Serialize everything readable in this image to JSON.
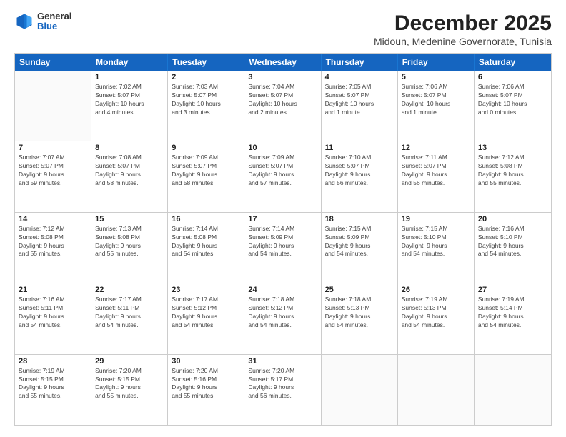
{
  "header": {
    "logo": {
      "general": "General",
      "blue": "Blue"
    },
    "title": "December 2025",
    "subtitle": "Midoun, Medenine Governorate, Tunisia"
  },
  "calendar": {
    "days_of_week": [
      "Sunday",
      "Monday",
      "Tuesday",
      "Wednesday",
      "Thursday",
      "Friday",
      "Saturday"
    ],
    "weeks": [
      [
        {
          "day": "",
          "info": ""
        },
        {
          "day": "1",
          "info": "Sunrise: 7:02 AM\nSunset: 5:07 PM\nDaylight: 10 hours\nand 4 minutes."
        },
        {
          "day": "2",
          "info": "Sunrise: 7:03 AM\nSunset: 5:07 PM\nDaylight: 10 hours\nand 3 minutes."
        },
        {
          "day": "3",
          "info": "Sunrise: 7:04 AM\nSunset: 5:07 PM\nDaylight: 10 hours\nand 2 minutes."
        },
        {
          "day": "4",
          "info": "Sunrise: 7:05 AM\nSunset: 5:07 PM\nDaylight: 10 hours\nand 1 minute."
        },
        {
          "day": "5",
          "info": "Sunrise: 7:06 AM\nSunset: 5:07 PM\nDaylight: 10 hours\nand 1 minute."
        },
        {
          "day": "6",
          "info": "Sunrise: 7:06 AM\nSunset: 5:07 PM\nDaylight: 10 hours\nand 0 minutes."
        }
      ],
      [
        {
          "day": "7",
          "info": "Sunrise: 7:07 AM\nSunset: 5:07 PM\nDaylight: 9 hours\nand 59 minutes."
        },
        {
          "day": "8",
          "info": "Sunrise: 7:08 AM\nSunset: 5:07 PM\nDaylight: 9 hours\nand 58 minutes."
        },
        {
          "day": "9",
          "info": "Sunrise: 7:09 AM\nSunset: 5:07 PM\nDaylight: 9 hours\nand 58 minutes."
        },
        {
          "day": "10",
          "info": "Sunrise: 7:09 AM\nSunset: 5:07 PM\nDaylight: 9 hours\nand 57 minutes."
        },
        {
          "day": "11",
          "info": "Sunrise: 7:10 AM\nSunset: 5:07 PM\nDaylight: 9 hours\nand 56 minutes."
        },
        {
          "day": "12",
          "info": "Sunrise: 7:11 AM\nSunset: 5:07 PM\nDaylight: 9 hours\nand 56 minutes."
        },
        {
          "day": "13",
          "info": "Sunrise: 7:12 AM\nSunset: 5:08 PM\nDaylight: 9 hours\nand 55 minutes."
        }
      ],
      [
        {
          "day": "14",
          "info": "Sunrise: 7:12 AM\nSunset: 5:08 PM\nDaylight: 9 hours\nand 55 minutes."
        },
        {
          "day": "15",
          "info": "Sunrise: 7:13 AM\nSunset: 5:08 PM\nDaylight: 9 hours\nand 55 minutes."
        },
        {
          "day": "16",
          "info": "Sunrise: 7:14 AM\nSunset: 5:08 PM\nDaylight: 9 hours\nand 54 minutes."
        },
        {
          "day": "17",
          "info": "Sunrise: 7:14 AM\nSunset: 5:09 PM\nDaylight: 9 hours\nand 54 minutes."
        },
        {
          "day": "18",
          "info": "Sunrise: 7:15 AM\nSunset: 5:09 PM\nDaylight: 9 hours\nand 54 minutes."
        },
        {
          "day": "19",
          "info": "Sunrise: 7:15 AM\nSunset: 5:10 PM\nDaylight: 9 hours\nand 54 minutes."
        },
        {
          "day": "20",
          "info": "Sunrise: 7:16 AM\nSunset: 5:10 PM\nDaylight: 9 hours\nand 54 minutes."
        }
      ],
      [
        {
          "day": "21",
          "info": "Sunrise: 7:16 AM\nSunset: 5:11 PM\nDaylight: 9 hours\nand 54 minutes."
        },
        {
          "day": "22",
          "info": "Sunrise: 7:17 AM\nSunset: 5:11 PM\nDaylight: 9 hours\nand 54 minutes."
        },
        {
          "day": "23",
          "info": "Sunrise: 7:17 AM\nSunset: 5:12 PM\nDaylight: 9 hours\nand 54 minutes."
        },
        {
          "day": "24",
          "info": "Sunrise: 7:18 AM\nSunset: 5:12 PM\nDaylight: 9 hours\nand 54 minutes."
        },
        {
          "day": "25",
          "info": "Sunrise: 7:18 AM\nSunset: 5:13 PM\nDaylight: 9 hours\nand 54 minutes."
        },
        {
          "day": "26",
          "info": "Sunrise: 7:19 AM\nSunset: 5:13 PM\nDaylight: 9 hours\nand 54 minutes."
        },
        {
          "day": "27",
          "info": "Sunrise: 7:19 AM\nSunset: 5:14 PM\nDaylight: 9 hours\nand 54 minutes."
        }
      ],
      [
        {
          "day": "28",
          "info": "Sunrise: 7:19 AM\nSunset: 5:15 PM\nDaylight: 9 hours\nand 55 minutes."
        },
        {
          "day": "29",
          "info": "Sunrise: 7:20 AM\nSunset: 5:15 PM\nDaylight: 9 hours\nand 55 minutes."
        },
        {
          "day": "30",
          "info": "Sunrise: 7:20 AM\nSunset: 5:16 PM\nDaylight: 9 hours\nand 55 minutes."
        },
        {
          "day": "31",
          "info": "Sunrise: 7:20 AM\nSunset: 5:17 PM\nDaylight: 9 hours\nand 56 minutes."
        },
        {
          "day": "",
          "info": ""
        },
        {
          "day": "",
          "info": ""
        },
        {
          "day": "",
          "info": ""
        }
      ]
    ]
  }
}
